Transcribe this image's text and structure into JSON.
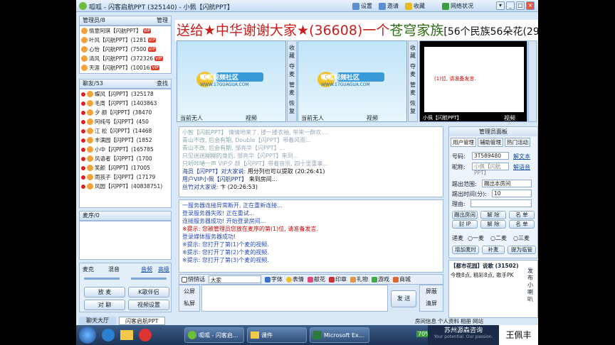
{
  "titlebar": {
    "title": "呱呱 - 闪客启航PPT (325140) - 小佩【闪航PPT】",
    "btn_settings": "设置",
    "btn_invite": "邀请",
    "btn_fav": "收藏",
    "btn_net": "网络状况"
  },
  "admin_panel": {
    "title": "管理员/8",
    "manage": "管理",
    "users": [
      {
        "name": "情意阿琪【闪航PPT】",
        "badge": "VIP"
      },
      {
        "name": "叶风【闪航PPT】(1281",
        "badge": "VIP"
      },
      {
        "name": "心怡【闪航PPT】(7500",
        "badge": "VIP"
      },
      {
        "name": "清风【闪航PPT】(372326",
        "badge": "VIP"
      },
      {
        "name": "天涯【闪航PPT】(10016",
        "badge": "VIP"
      }
    ]
  },
  "chat_panel": {
    "title": "聊友/53",
    "search": "查找",
    "users": [
      "蝶风【闪PPT】(325178",
      "毛周【闪PPT】(1403863",
      "夕 颜【闪PPT】(38470",
      "阿纯号【闪PPT】(450",
      "江 松【闪PPT】(14468",
      "丰满园【闪PPT】(1852",
      "小中【闪PPT】(165785",
      "风语者【闪PPT】(1700",
      "笑颜【闪PPT】(17005",
      "雨孩子【闪PPT】(17179",
      "风园【闪PPT】(40838751)"
    ]
  },
  "mic_queue": {
    "title": "麦序/0"
  },
  "mic_controls": {
    "mic": "麦克",
    "drop": "混音",
    "volume": "音频",
    "advanced": "高级",
    "pause": "放 麦",
    "ktv": "K歌伴侣",
    "dialog": "对 聊",
    "video_settings": "视频设置"
  },
  "banner": {
    "text": "送给★中华谢谢大家★(36608)一个",
    "highlight": "苍穹家族",
    "tail": "[56个民族56朵花(29"
  },
  "videos": [
    {
      "caption": "当前无人",
      "tag": "视频",
      "side": [
        "收 藏",
        "夺 麦",
        "管 麦",
        "恢 复"
      ]
    },
    {
      "caption": "当前无人",
      "tag": "视频",
      "side": [
        "收 藏",
        "夺 麦",
        "管 麦",
        "恢 复"
      ]
    },
    {
      "caption": "小佩【闪航PPT】",
      "tag": "视频"
    }
  ],
  "logo_text": "呱呱视频社区",
  "logo_url": "WWW.17GUAGUA.COM",
  "video3_text": "(1)位, 请准备发言.",
  "public_chat": [
    {
      "s": "小智【闪航PPT】",
      "t": "情情地来了, 搂一搂衣袖, 带来一群欢...."
    },
    {
      "s": "青山不改, 后会有期,",
      "t": "Double【闪PPT】带着风雨..."
    },
    {
      "s": "青山不改, 后会有期,",
      "t": "邹亮华【闪PPT】..."
    },
    {
      "s": "只见迷迷糊糊的身后,",
      "t": "邹亮华【闪PPT】来到..."
    },
    {
      "s": "只听咔嗵一声",
      "t": "VIP夕 颜【闪PPT】带着音乐, 四十里重事..."
    },
    {
      "s": "海员【闪PPT】对大家说:",
      "t": "用分列也可以提取 (20:26:41)"
    },
    {
      "s": "用户VIP小佩【闪航PPT】",
      "t": "来到房间..."
    },
    {
      "s": "丝竹对大家说:",
      "t": "卞 (20:26:53)"
    }
  ],
  "system_log": [
    "一服务器连接异常断开, 正在重新连接...",
    "登录服务器失败! 正在重试...",
    "连接服务器成功! 开始登录房间...",
    "※提示: 您被管理员您放在麦序的第(1)位, 请准备发言.",
    "登录媒体服务器成功!",
    "※提示: 您打开了第(1)个麦的视频.",
    "※提示: 您打开了第(2)个麦的视频.",
    "※提示: 您打开了第(3)个麦的视频."
  ],
  "input_bar": {
    "whisper": "悄悄话",
    "target": "大家",
    "font": "字体",
    "emoji": "表情",
    "flower": "献花",
    "stamp": "印章",
    "gift": "礼物",
    "game": "游戏",
    "mall": "商城",
    "clear_public": "公屏",
    "clear_private": "私屏",
    "send": "发 送",
    "clear": "屏蔽",
    "clear2": "清屏"
  },
  "admin_side": {
    "title": "管理员面板",
    "tab1": "用户管理",
    "tab2": "辅助管理",
    "tab3": "热门活动",
    "id_label": "号码:",
    "id_value": "3T589480",
    "id_btn": "解文本",
    "nick_label": "昵称:",
    "nick_value": "小佩【闪航PPT】",
    "nick_btn": "解语音",
    "kick_label": "踢出范围:",
    "kick_value": "踢出本房间",
    "kick_time_label": "踢出时间(分):",
    "kick_time_value": "10",
    "reason_label": "理由:",
    "buttons": [
      "踢出房间",
      "解 除",
      "名 单",
      "封 IP",
      "解 除",
      "名 单"
    ],
    "order": "递麦",
    "o1": "一麦",
    "o2": "二麦",
    "o3": "三麦",
    "add_time": "增加麦时",
    "give_mic": "补麦",
    "promote": "提为临管"
  },
  "bottom_side": {
    "title": "【都市花园】说歌 (31502)",
    "line1": "今晚8点, 精彩8点, 歌手PK",
    "vertical": "发布小喇叭",
    "right_tab1": "房间信息",
    "right_tab2": "个人资料",
    "right_tab3": "相册",
    "right_tab4": "网站"
  },
  "room_tabs": {
    "lobby": "聊天大厅",
    "room": "闪客启航PPT"
  },
  "taskbar": {
    "t1": "呱呱 - 闪客启...",
    "t2": "课件",
    "t3": "Microsoft Ex...",
    "pct": "70%",
    "brand": "苏州源森咨询",
    "brand2": "Your potential. Our passion.",
    "user": "王佩丰"
  }
}
